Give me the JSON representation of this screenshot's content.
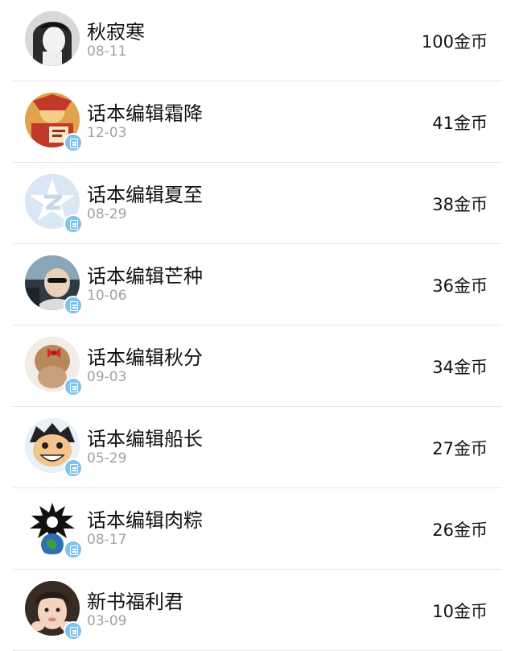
{
  "list": [
    {
      "name": "秋寂寒",
      "date": "08-11",
      "coins": "100金币",
      "badge": false,
      "avatar_icon": "bw-person-avatar"
    },
    {
      "name": "话本编辑霜降",
      "date": "12-03",
      "coins": "41金币",
      "badge": true,
      "avatar_icon": "cartoon-avatar"
    },
    {
      "name": "话本编辑夏至",
      "date": "08-29",
      "coins": "38金币",
      "badge": true,
      "avatar_icon": "default-qq-avatar"
    },
    {
      "name": "话本编辑芒种",
      "date": "10-06",
      "coins": "36金币",
      "badge": true,
      "avatar_icon": "car-person-avatar"
    },
    {
      "name": "话本编辑秋分",
      "date": "09-03",
      "coins": "34金币",
      "badge": true,
      "avatar_icon": "hair-bow-avatar"
    },
    {
      "name": "话本编辑船长",
      "date": "05-29",
      "coins": "27金币",
      "badge": true,
      "avatar_icon": "luffy-avatar"
    },
    {
      "name": "话本编辑肉粽",
      "date": "08-17",
      "coins": "26金币",
      "badge": true,
      "avatar_icon": "spiky-globe-avatar"
    },
    {
      "name": "新书福利君",
      "date": "03-09",
      "coins": "10金币",
      "badge": true,
      "avatar_icon": "girl-avatar"
    }
  ],
  "colors": {
    "badge": "#7ec3ef",
    "divider": "#e5e5e5",
    "date_text": "#a2a2a2"
  }
}
